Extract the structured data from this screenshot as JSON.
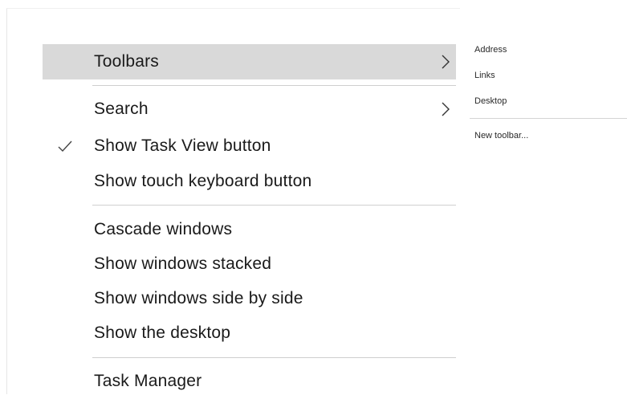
{
  "context_menu": {
    "items": [
      {
        "label": "Toolbars",
        "submenu": true,
        "checked": false,
        "highlighted": true
      },
      {
        "label": "Search",
        "submenu": true,
        "checked": false,
        "highlighted": false
      },
      {
        "label": "Show Task View button",
        "submenu": false,
        "checked": true,
        "highlighted": false
      },
      {
        "label": "Show touch keyboard button",
        "submenu": false,
        "checked": false,
        "highlighted": false
      },
      {
        "label": "Cascade windows",
        "submenu": false,
        "checked": false,
        "highlighted": false
      },
      {
        "label": "Show windows stacked",
        "submenu": false,
        "checked": false,
        "highlighted": false
      },
      {
        "label": "Show windows side by side",
        "submenu": false,
        "checked": false,
        "highlighted": false
      },
      {
        "label": "Show the desktop",
        "submenu": false,
        "checked": false,
        "highlighted": false
      },
      {
        "label": "Task Manager",
        "submenu": false,
        "checked": false,
        "highlighted": false
      }
    ],
    "highlight_color": "#d9d9d9"
  },
  "toolbars_submenu": {
    "items": [
      {
        "label": "Address"
      },
      {
        "label": "Links"
      },
      {
        "label": "Desktop"
      },
      {
        "label": "New toolbar..."
      }
    ]
  },
  "icons": {
    "submenu_arrow": "chevron-right-icon",
    "check": "checkmark-icon"
  }
}
